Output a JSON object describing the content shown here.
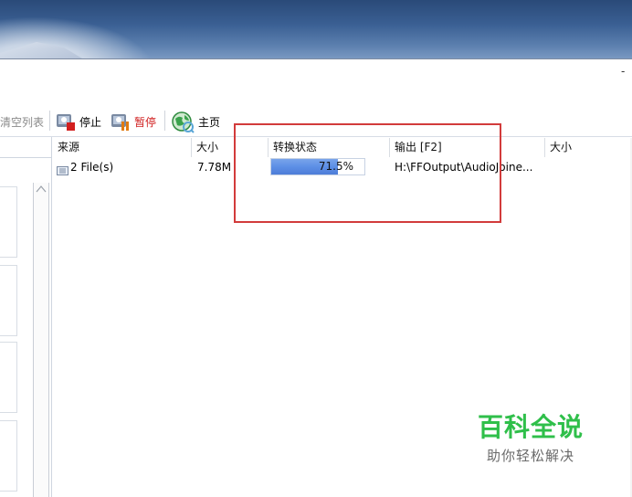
{
  "desktop": {},
  "window": {
    "minimize_label": "-"
  },
  "toolbar": {
    "clear_list": "清空列表",
    "stop": "停止",
    "pause": "暂停",
    "home": "主页"
  },
  "table": {
    "headers": [
      "来源",
      "大小",
      "转换状态",
      "输出 [F2]",
      "大小"
    ],
    "rows": [
      {
        "source": "2 File(s)",
        "size": "7.78M",
        "progress_text": "71.5%",
        "progress": 0.715,
        "output": "H:\\FFOutput\\AudioJoine...",
        "out_size": ""
      }
    ]
  },
  "watermark": {
    "title": "百科全说",
    "subtitle": "助你轻松解决"
  },
  "colors": {
    "highlight": "#d23b3b",
    "progress": "#5d8fe6",
    "watermark": "#2fbf4a"
  }
}
